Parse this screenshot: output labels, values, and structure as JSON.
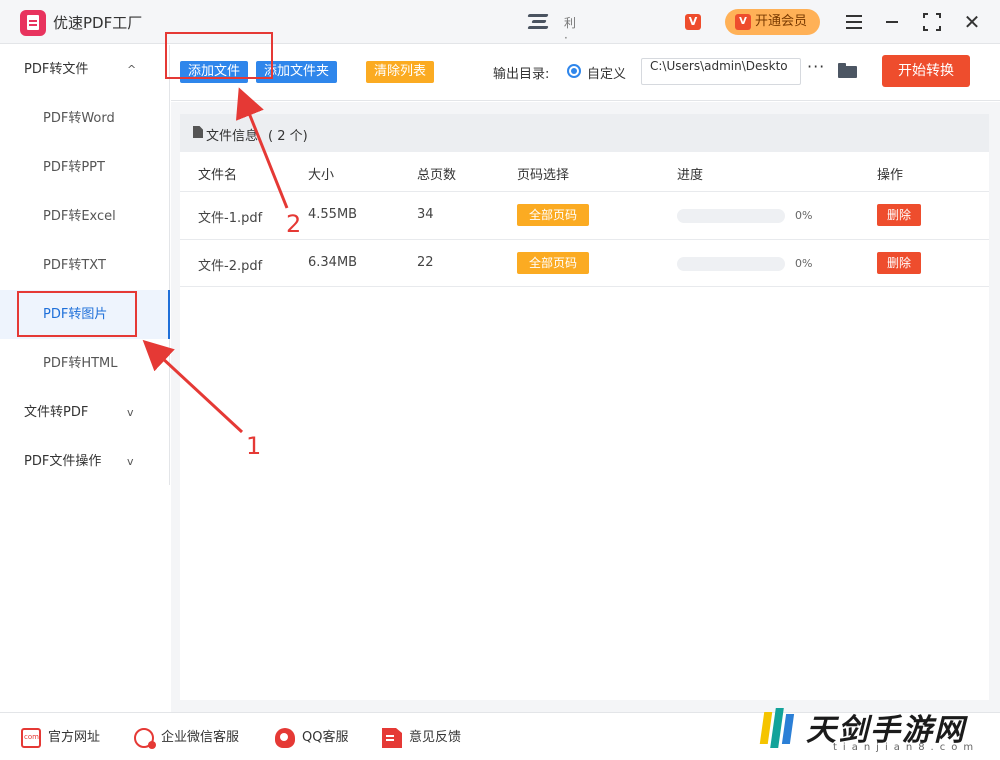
{
  "app": {
    "title": "优速PDF工厂",
    "user_name": "利 ·",
    "vip_badge": "V",
    "member_button": "开通会员"
  },
  "sidebar": {
    "groups": [
      {
        "label": "PDF转文件",
        "expanded": true
      },
      {
        "label": "文件转PDF",
        "expanded": false
      },
      {
        "label": "PDF文件操作",
        "expanded": false
      }
    ],
    "items": [
      {
        "label": "PDF转Word"
      },
      {
        "label": "PDF转PPT"
      },
      {
        "label": "PDF转Excel"
      },
      {
        "label": "PDF转TXT"
      },
      {
        "label": "PDF转图片",
        "active": true
      },
      {
        "label": "PDF转HTML"
      }
    ],
    "chevron_up": "^",
    "chevron_down": "v"
  },
  "toolbar": {
    "add_file": "添加文件",
    "add_folder": "添加文件夹",
    "clear_list": "清除列表",
    "output_label": "输出目录:",
    "custom_option": "自定义",
    "path_value": "C:\\Users\\admin\\Deskto",
    "more": "···",
    "start": "开始转换"
  },
  "file_panel": {
    "title": "文件信息",
    "count": "( 2 个)",
    "columns": [
      "文件名",
      "大小",
      "总页数",
      "页码选择",
      "进度",
      "操作"
    ],
    "rows": [
      {
        "name": "文件-1.pdf",
        "size": "4.55MB",
        "pages": "34",
        "page_select": "全部页码",
        "progress": 0,
        "progress_text": "0%",
        "action": "删除"
      },
      {
        "name": "文件-2.pdf",
        "size": "6.34MB",
        "pages": "22",
        "page_select": "全部页码",
        "progress": 0,
        "progress_text": "0%",
        "action": "删除"
      }
    ]
  },
  "annotations": {
    "step1": "1",
    "step2": "2"
  },
  "footer": {
    "website": "官方网址",
    "wechat": "企业微信客服",
    "qq": "QQ客服",
    "feedback": "意见反馈"
  },
  "watermark": {
    "name": "天剑手游网",
    "domain": "tianjian8.com"
  },
  "colors": {
    "primary_blue": "#2f86eb",
    "orange": "#fbab22",
    "red": "#ee4d2d",
    "annotation_red": "#e53935"
  }
}
